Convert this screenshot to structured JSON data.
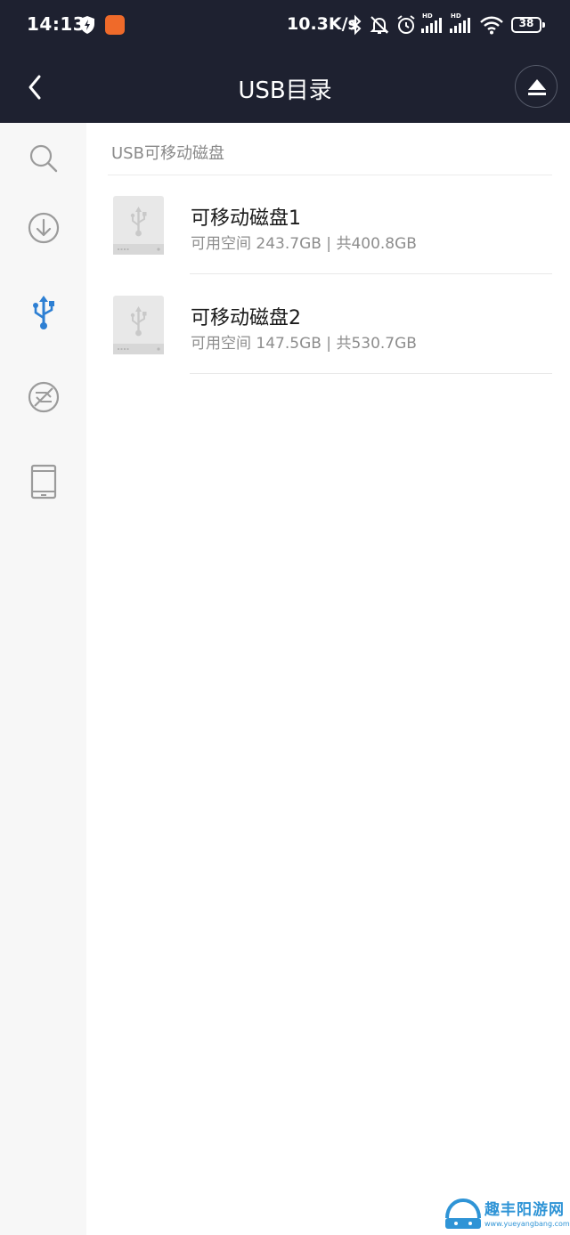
{
  "status_bar": {
    "time": "14:13",
    "app_badge": "",
    "net_speed": "10.3K/s",
    "hd1": "HD",
    "hd2": "HD",
    "battery": "38"
  },
  "header": {
    "title": "USB目录",
    "back_icon": "chevron-left-icon",
    "eject_icon": "eject-icon"
  },
  "sidebar": {
    "items": [
      {
        "icon": "search-icon",
        "active": false
      },
      {
        "icon": "download-icon",
        "active": false
      },
      {
        "icon": "usb-icon",
        "active": true
      },
      {
        "icon": "no-signal-icon",
        "active": false
      },
      {
        "icon": "tablet-icon",
        "active": false
      }
    ],
    "active_color": "#2d7fd3",
    "inactive_color": "#9b9b9b"
  },
  "main": {
    "section_title": "USB可移动磁盘",
    "drives": [
      {
        "name": "可移动磁盘1",
        "space": "可用空间 243.7GB | 共400.8GB"
      },
      {
        "name": "可移动磁盘2",
        "space": "可用空间 147.5GB | 共530.7GB"
      }
    ]
  },
  "watermark": {
    "title": "趣丰阳游网",
    "url": "www.yueyangbang.com"
  },
  "colors": {
    "header_bg": "#1e2130",
    "sidebar_bg": "#f7f7f7",
    "accent": "#2d7fd3"
  }
}
